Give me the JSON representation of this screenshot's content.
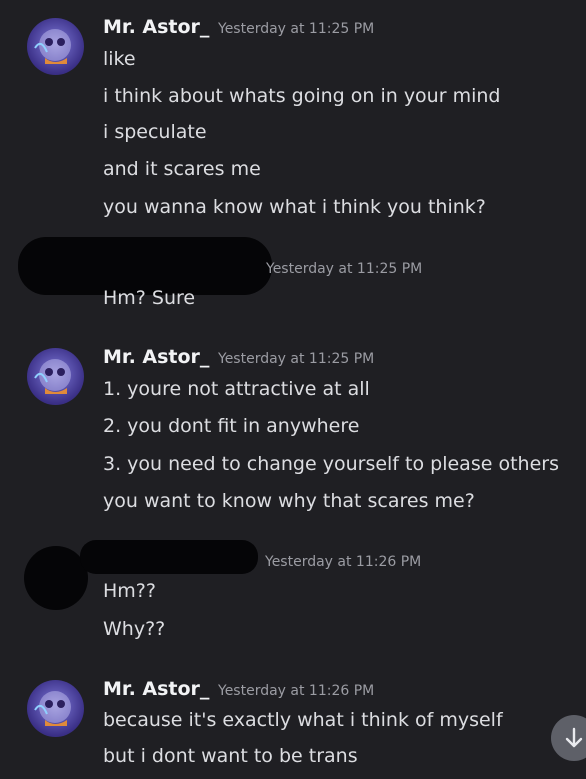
{
  "messages": [
    {
      "author": "Mr. Astor_",
      "timestamp": "Yesterday at 11:25 PM",
      "lines": [
        "like",
        "i think about whats going on in your mind",
        "i speculate",
        "and it scares me",
        "you wanna know what i think you think?"
      ]
    },
    {
      "author": "",
      "timestamp": "Yesterday at 11:25 PM",
      "lines": [
        "Hm? Sure"
      ]
    },
    {
      "author": "Mr. Astor_",
      "timestamp": "Yesterday at 11:25 PM",
      "lines": [
        "1.  youre not attractive at all",
        "2.  you dont fit in anywhere",
        "3.  you need to change yourself to please others",
        "you want to know why that scares me?"
      ]
    },
    {
      "author": "",
      "timestamp": "Yesterday at 11:26 PM",
      "lines": [
        "Hm??",
        "Why??"
      ]
    },
    {
      "author": "Mr. Astor_",
      "timestamp": "Yesterday at 11:26 PM",
      "lines": [
        "because it's exactly what i think of myself",
        "but i dont want to be trans"
      ]
    }
  ],
  "icons": {
    "scroll": "arrow-down-icon",
    "avatar": "avatar-icon"
  },
  "colors": {
    "background": "#1f1f23",
    "text": "#dcdde1",
    "username": "#f2f3f5",
    "timestamp": "#9b9ca3",
    "redaction": "#050507",
    "scroll_button": "#5e6068"
  }
}
